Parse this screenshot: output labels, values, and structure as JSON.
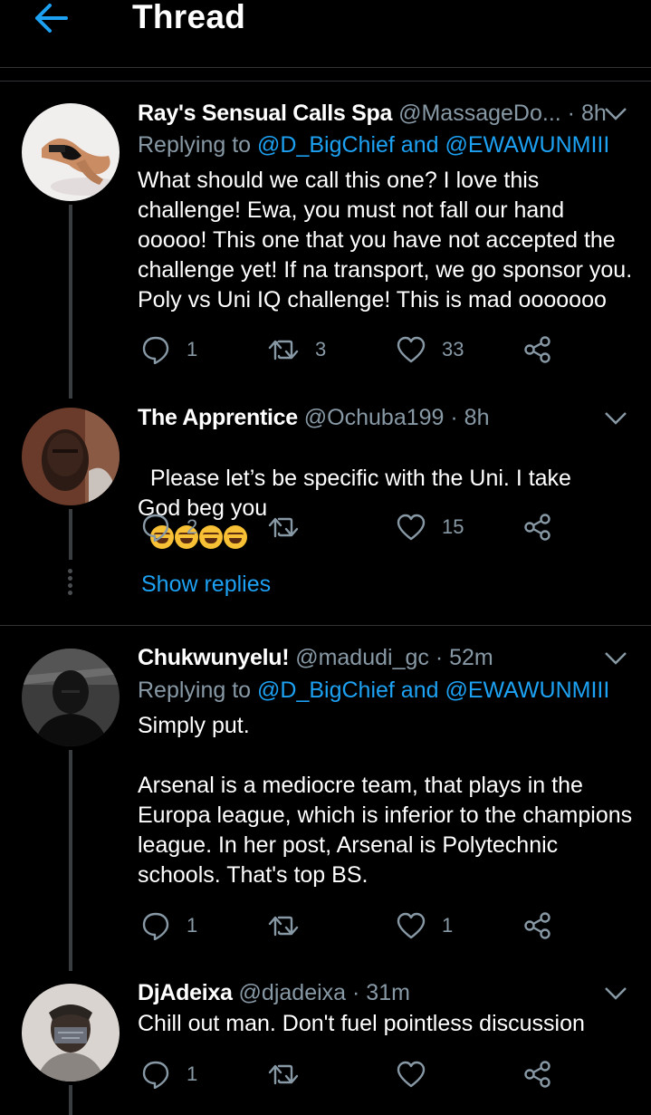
{
  "header": {
    "title": "Thread",
    "back_icon": "arrow-left-icon",
    "accent": "#1da1f2"
  },
  "tweets": [
    {
      "name": "Ray's Sensual Calls Spa",
      "handle": "@MassageDo...",
      "time": "· 8h",
      "replying_prefix": "Replying to",
      "replying_users": "@D_BigChief and @EWAWUNMIII",
      "body": "What should we call this one? I love this challenge! Ewa, you must not fall our hand ooooo! This one that you have not accepted the challenge yet! If na transport, we go sponsor you. Poly vs Uni IQ challenge! This is mad ooooooo",
      "replies": "1",
      "retweets": "3",
      "likes": "33"
    },
    {
      "name": "The Apprentice",
      "handle": "@Ochuba199",
      "time": "· 8h",
      "body": "Please let’s be specific with the Uni. I take God beg you",
      "emoji_count": 4,
      "emoji": "😂",
      "replies": "2",
      "retweets": "",
      "likes": "15"
    },
    {
      "name": "Chukwunyelu!",
      "handle": "@madudi_gc",
      "time": "· 52m",
      "replying_prefix": "Replying to",
      "replying_users": "@D_BigChief and @EWAWUNMIII",
      "body": "Simply put.\n\nArsenal is a mediocre team, that plays in the Europa league, which is inferior to the champions league. In her post, Arsenal is Polytechnic schools. That's top BS.",
      "replies": "1",
      "retweets": "",
      "likes": "1"
    },
    {
      "name": "DjAdeixa",
      "handle": "@djadeixa",
      "time": "· 31m",
      "body": "Chill out man. Don't fuel pointless discussion",
      "replies": "1",
      "retweets": "",
      "likes": ""
    }
  ],
  "show_replies": "Show replies",
  "icons": {
    "reply": "reply-icon",
    "retweet": "retweet-icon",
    "like": "heart-icon",
    "share": "share-icon",
    "caret": "chevron-down-icon"
  },
  "colors": {
    "background": "#000000",
    "text": "#ffffff",
    "muted": "#8899a6",
    "link": "#1da1f2",
    "border": "#2f3336"
  }
}
